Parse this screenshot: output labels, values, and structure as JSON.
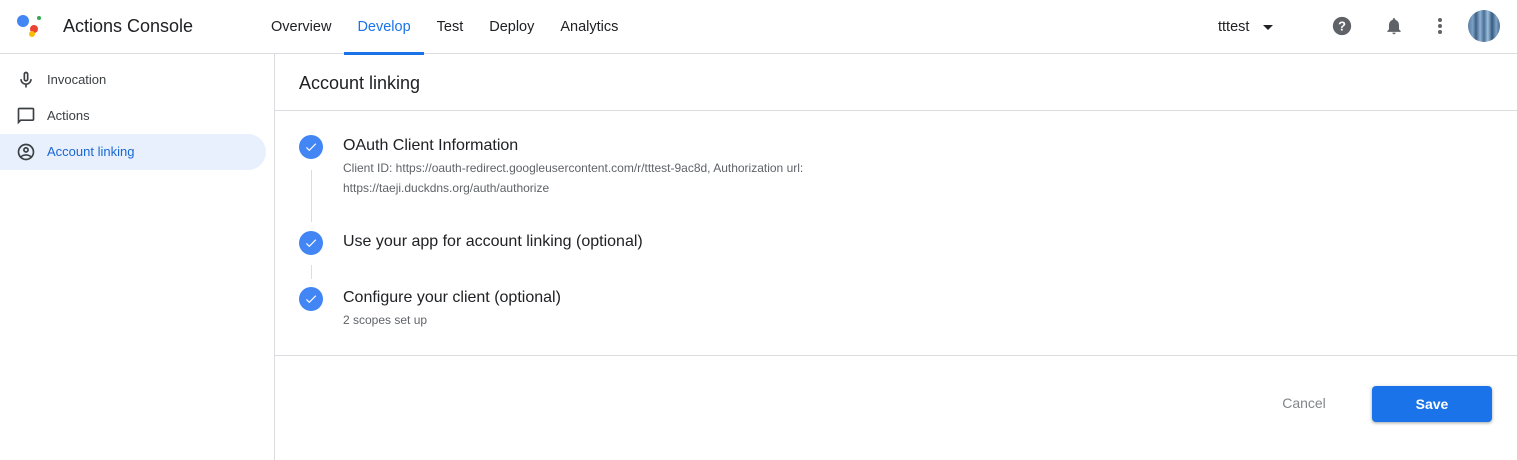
{
  "app": {
    "title": "Actions Console"
  },
  "nav": {
    "tabs": [
      {
        "label": "Overview",
        "active": false
      },
      {
        "label": "Develop",
        "active": true
      },
      {
        "label": "Test",
        "active": false
      },
      {
        "label": "Deploy",
        "active": false
      },
      {
        "label": "Analytics",
        "active": false
      }
    ]
  },
  "header": {
    "project": "tttest",
    "icons": [
      "help-icon",
      "notifications-icon",
      "more-vert-icon"
    ]
  },
  "sidebar": {
    "items": [
      {
        "label": "Invocation",
        "icon": "mic-icon",
        "active": false
      },
      {
        "label": "Actions",
        "icon": "chat-bubble-icon",
        "active": false
      },
      {
        "label": "Account linking",
        "icon": "account-circle-icon",
        "active": true
      }
    ]
  },
  "main": {
    "title": "Account linking",
    "steps": [
      {
        "title": "OAuth Client Information",
        "subtitle": "Client ID: https://oauth-redirect.googleusercontent.com/r/tttest-9ac8d, Authorization url: https://taeji.duckdns.org/auth/authorize",
        "done": true
      },
      {
        "title": "Use your app for account linking (optional)",
        "subtitle": "",
        "done": true
      },
      {
        "title": "Configure your client (optional)",
        "subtitle": "2 scopes set up",
        "done": true
      }
    ],
    "cancel_label": "Cancel",
    "save_label": "Save"
  },
  "colors": {
    "accent": "#1a73e8",
    "check": "#4285f4",
    "active_bg": "#e8f0fe"
  }
}
